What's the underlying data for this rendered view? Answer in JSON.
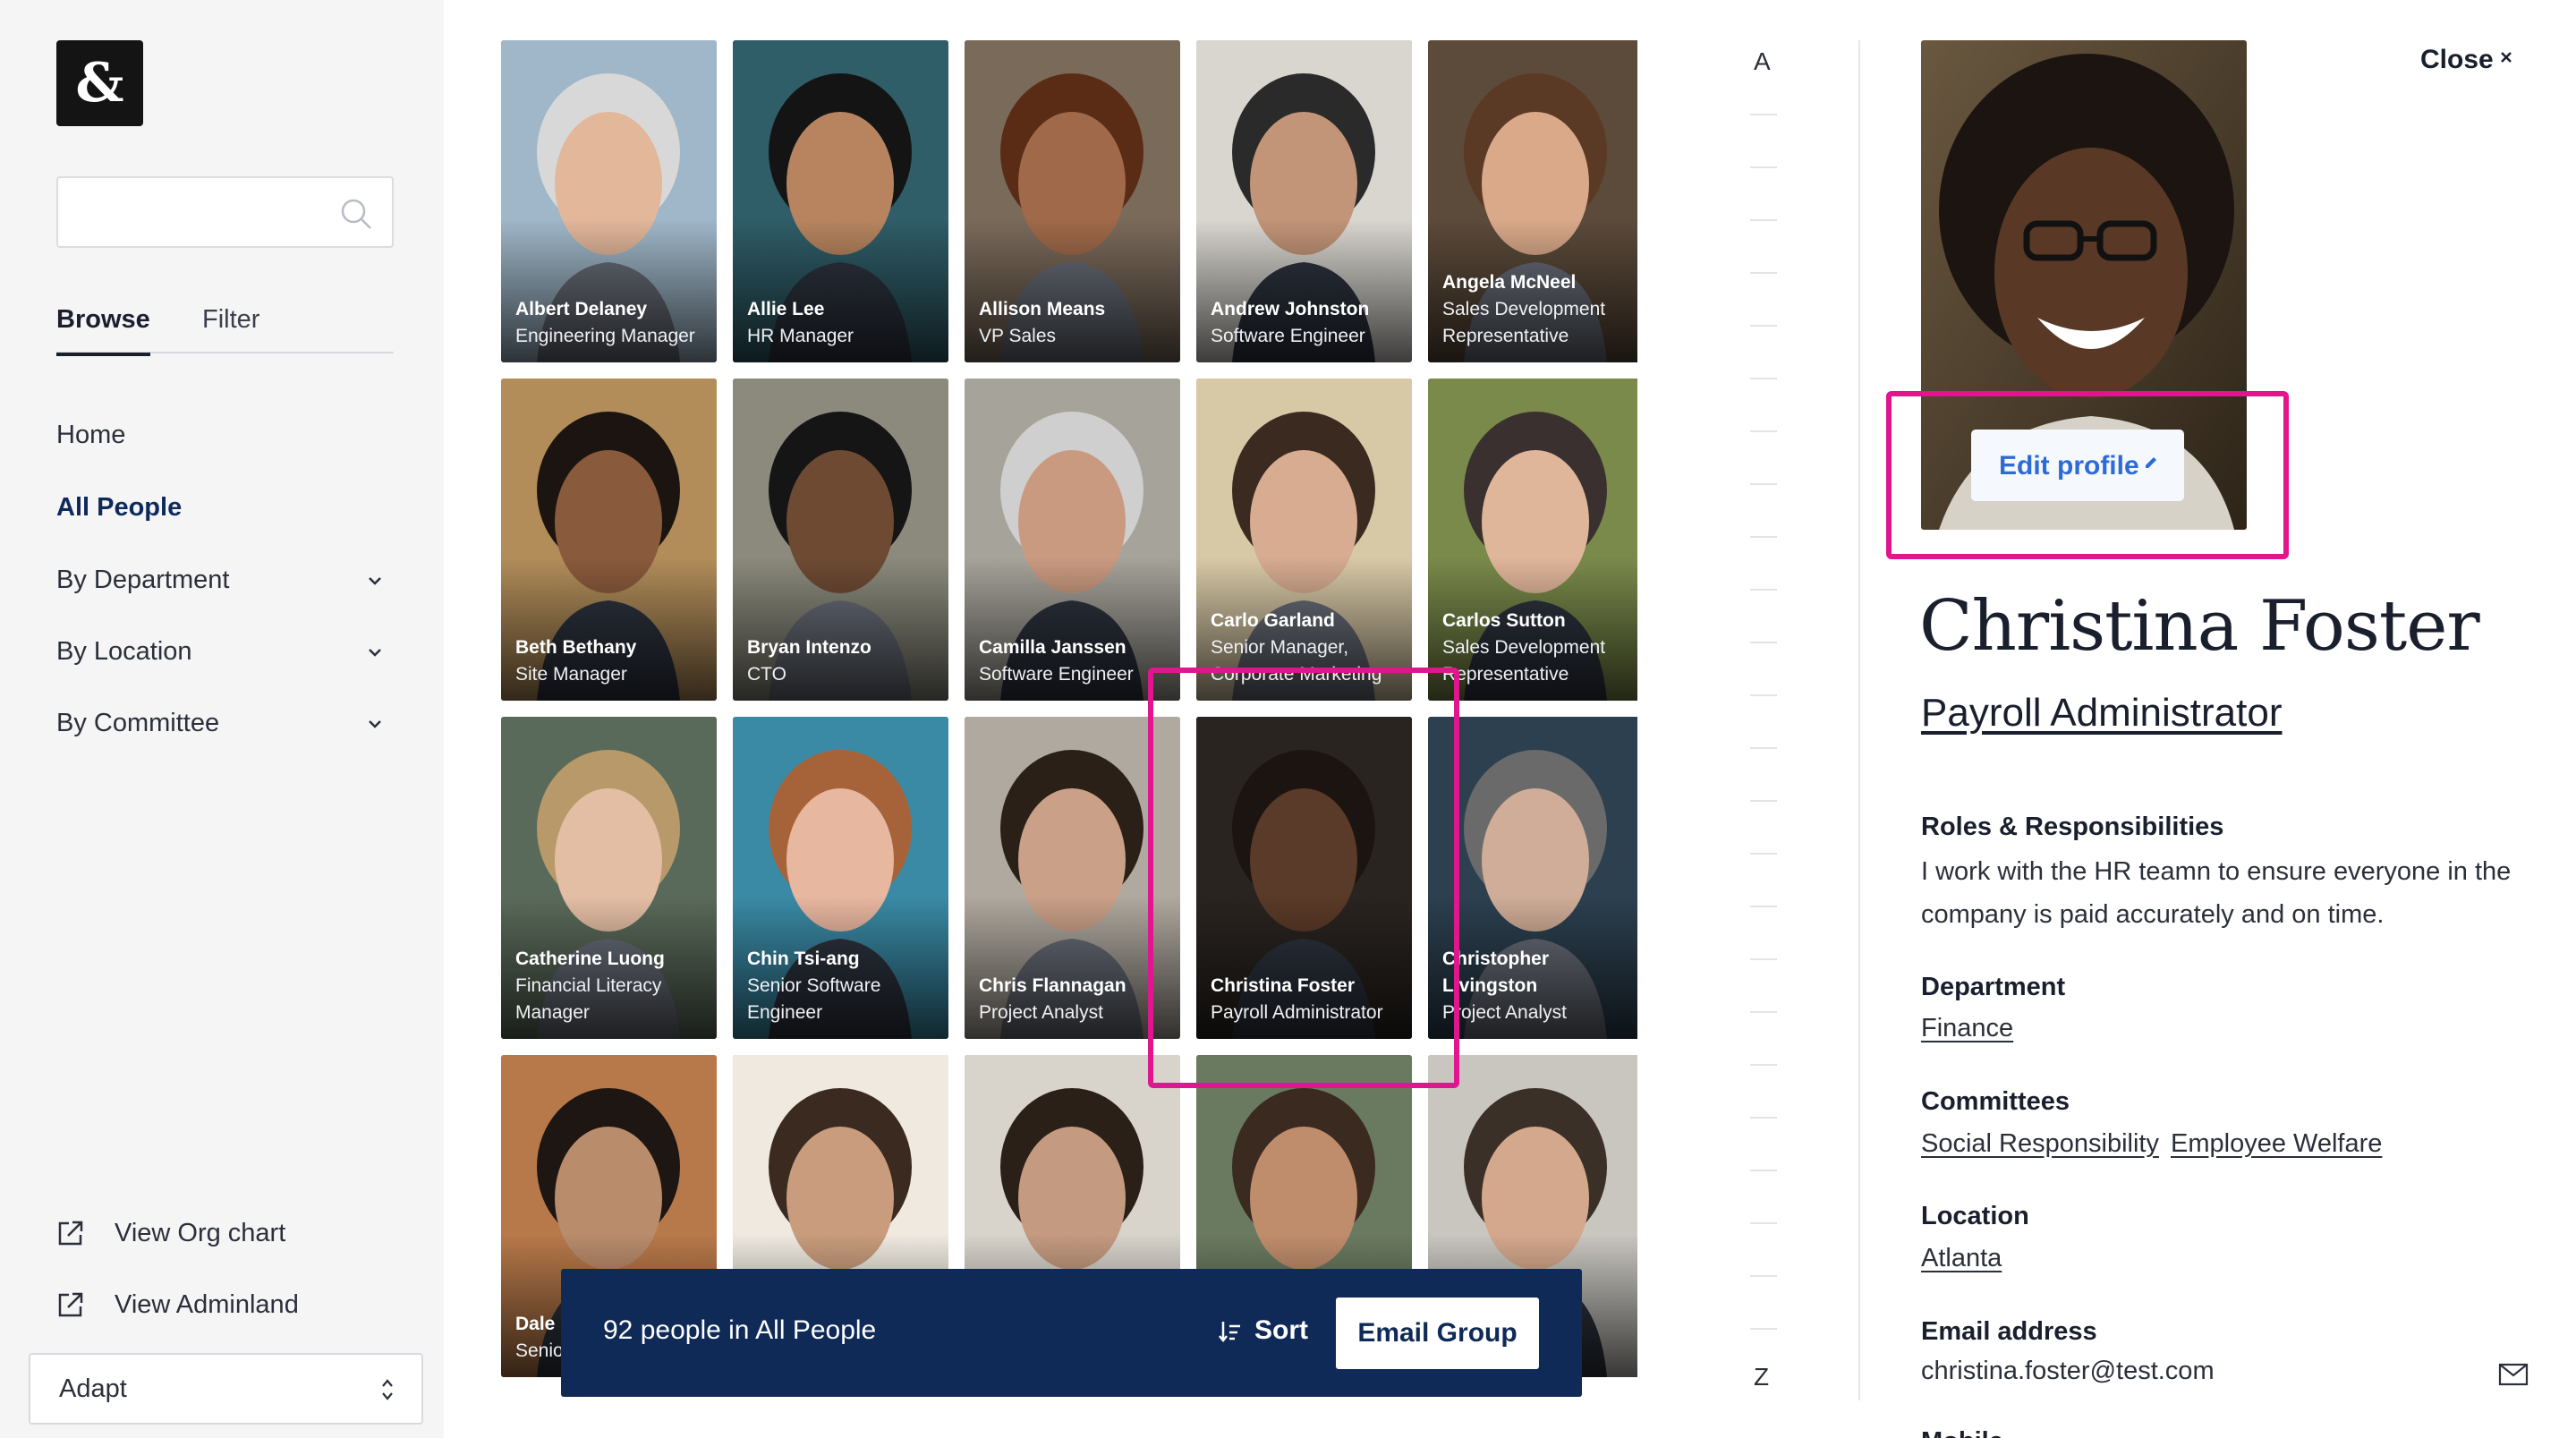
{
  "sidebar": {
    "logo": "&",
    "search": {
      "value": "",
      "placeholder": ""
    },
    "tabs": [
      {
        "label": "Browse",
        "active": true
      },
      {
        "label": "Filter",
        "active": false
      }
    ],
    "nav": [
      {
        "label": "Home",
        "active": false,
        "expandable": false
      },
      {
        "label": "All People",
        "active": true,
        "expandable": false
      },
      {
        "label": "By Department",
        "active": false,
        "expandable": true
      },
      {
        "label": "By Location",
        "active": false,
        "expandable": true
      },
      {
        "label": "By Committee",
        "active": false,
        "expandable": true
      }
    ],
    "links": [
      {
        "label": "View Org chart"
      },
      {
        "label": "View Adminland"
      }
    ],
    "workspace": "Adapt"
  },
  "people": [
    {
      "name": "Albert Delaney",
      "title": "Engineering Manager"
    },
    {
      "name": "Allie Lee",
      "title": "HR Manager"
    },
    {
      "name": "Allison Means",
      "title": "VP Sales"
    },
    {
      "name": "Andrew Johnston",
      "title": "Software Engineer"
    },
    {
      "name": "Angela McNeel",
      "title": "Sales Development Representative"
    },
    {
      "name": "Beth Bethany",
      "title": "Site Manager"
    },
    {
      "name": "Bryan Intenzo",
      "title": "CTO"
    },
    {
      "name": "Camilla Janssen",
      "title": "Software Engineer"
    },
    {
      "name": "Carlo Garland",
      "title": "Senior Manager, Corporate Marketing"
    },
    {
      "name": "Carlos Sutton",
      "title": "Sales Development Representative"
    },
    {
      "name": "Catherine Luong",
      "title": "Financial Literacy Manager"
    },
    {
      "name": "Chin Tsi-ang",
      "title": "Senior Software Engineer"
    },
    {
      "name": "Chris Flannagan",
      "title": "Project Analyst"
    },
    {
      "name": "Christina Foster",
      "title": "Payroll Administrator"
    },
    {
      "name": "Christopher Livingston",
      "title": "Project Analyst"
    },
    {
      "name": "Dale",
      "title": "Senior Engineer"
    },
    {
      "name": "",
      "title": ""
    },
    {
      "name": "",
      "title": ""
    },
    {
      "name": "",
      "title": ""
    },
    {
      "name": "",
      "title": ""
    }
  ],
  "alphabet": {
    "first": "A",
    "last": "Z"
  },
  "bottom_bar": {
    "count": "92 people in All People",
    "sort": "Sort",
    "email": "Email Group"
  },
  "profile": {
    "close": "Close",
    "edit": "Edit profile",
    "name": "Christina Foster",
    "title": "Payroll Administrator",
    "roles_label": "Roles & Responsibilities",
    "roles_text": "I work with the HR teamn to ensure everyone in the company is paid accurately and on time.",
    "department_label": "Department",
    "department": "Finance",
    "committees_label": "Committees",
    "committees": [
      "Social Responsibility",
      "Employee Welfare"
    ],
    "location_label": "Location",
    "location": "Atlanta",
    "email_label": "Email address",
    "email": "christina.foster@test.com",
    "mobile_label": "Mobile"
  },
  "colors": {
    "accent": "#0f2a57",
    "highlight": "#e0168f",
    "link_blue": "#2d6bd6"
  },
  "icons": [
    "search-icon",
    "chevron-down-icon",
    "external-link-icon",
    "select-arrows-icon",
    "sort-icon",
    "close-icon",
    "pencil-icon",
    "mail-icon"
  ]
}
